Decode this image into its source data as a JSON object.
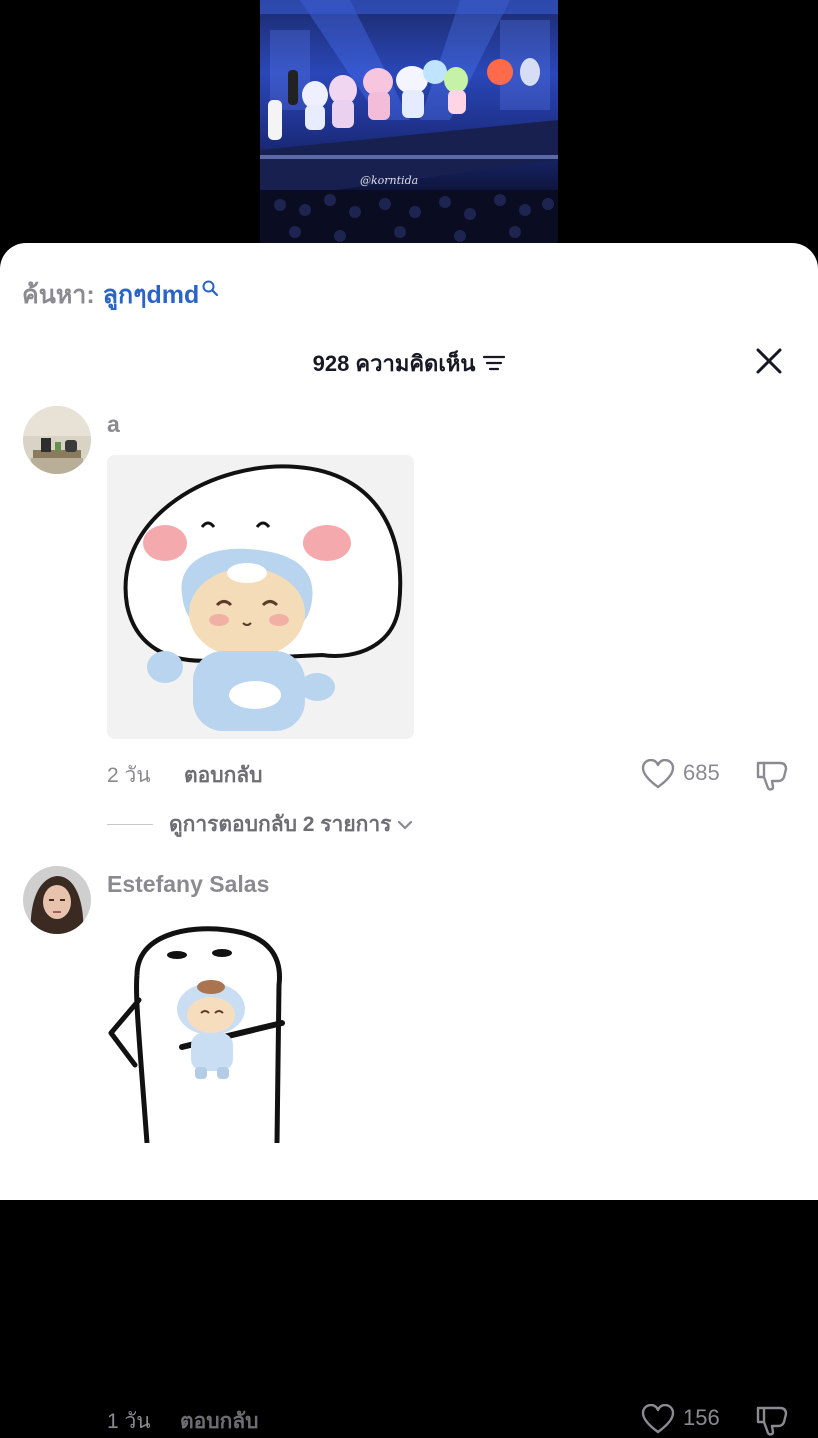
{
  "video": {
    "watermark": "@korntida"
  },
  "search": {
    "prefix": "ค้นหา:",
    "term": "ลูกๆdmd",
    "icon": "search-icon"
  },
  "header": {
    "comment_count_label": "928 ความคิดเห็น",
    "sort_icon": "sort-icon",
    "close_icon": "close-icon"
  },
  "comments": [
    {
      "username": "a",
      "time": "2 วัน",
      "reply_label": "ตอบกลับ",
      "likes": "685",
      "view_replies_label": "ดูการตอบกลับ 2 รายการ"
    },
    {
      "username": "Estefany Salas",
      "time": "1 วัน",
      "reply_label": "ตอบกลับ",
      "likes": "156"
    }
  ],
  "colors": {
    "accent": "#2a64c7",
    "muted_text": "#8a8b91",
    "primary_text": "#161823"
  }
}
